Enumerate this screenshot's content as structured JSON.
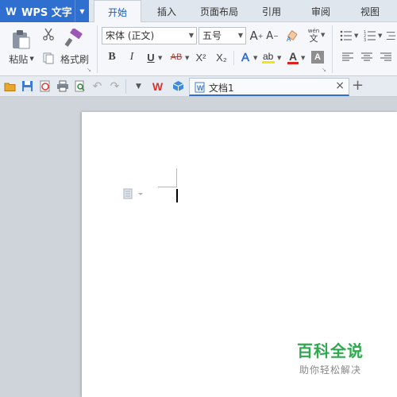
{
  "app": {
    "title": "WPS 文字",
    "logo_letter": "W",
    "colors": {
      "accent": "#2e6fd0",
      "watermark": "#2fa84f"
    }
  },
  "tabs": [
    {
      "label": "开始",
      "active": true
    },
    {
      "label": "插入",
      "active": false
    },
    {
      "label": "页面布局",
      "active": false
    },
    {
      "label": "引用",
      "active": false
    },
    {
      "label": "审阅",
      "active": false
    },
    {
      "label": "视图",
      "active": false
    }
  ],
  "ribbon": {
    "paste_label": "粘贴",
    "format_painter_label": "格式刷",
    "font_name": "宋体 (正文)",
    "font_size": "五号",
    "bold": "B",
    "italic": "I",
    "underline": "U",
    "strikethrough": "AB",
    "superscript": "X²",
    "subscript": "X₂",
    "grow_font": "A",
    "shrink_font": "A",
    "phonetic_top": "wén",
    "phonetic_bottom": "文",
    "font_color_letter": "A",
    "text_effect_letter": "A"
  },
  "quick_access": {
    "icons": [
      "open-icon",
      "save-icon",
      "export-pdf-icon",
      "print-icon",
      "print-preview-icon",
      "undo-icon",
      "redo-icon",
      "customize-icon",
      "wps-logo-icon",
      "cloud-cube-icon"
    ]
  },
  "document_tab": {
    "name": "文档1",
    "close": "×"
  },
  "new_tab": "+",
  "watermark": {
    "title": "百科全说",
    "subtitle": "助你轻松解决"
  }
}
